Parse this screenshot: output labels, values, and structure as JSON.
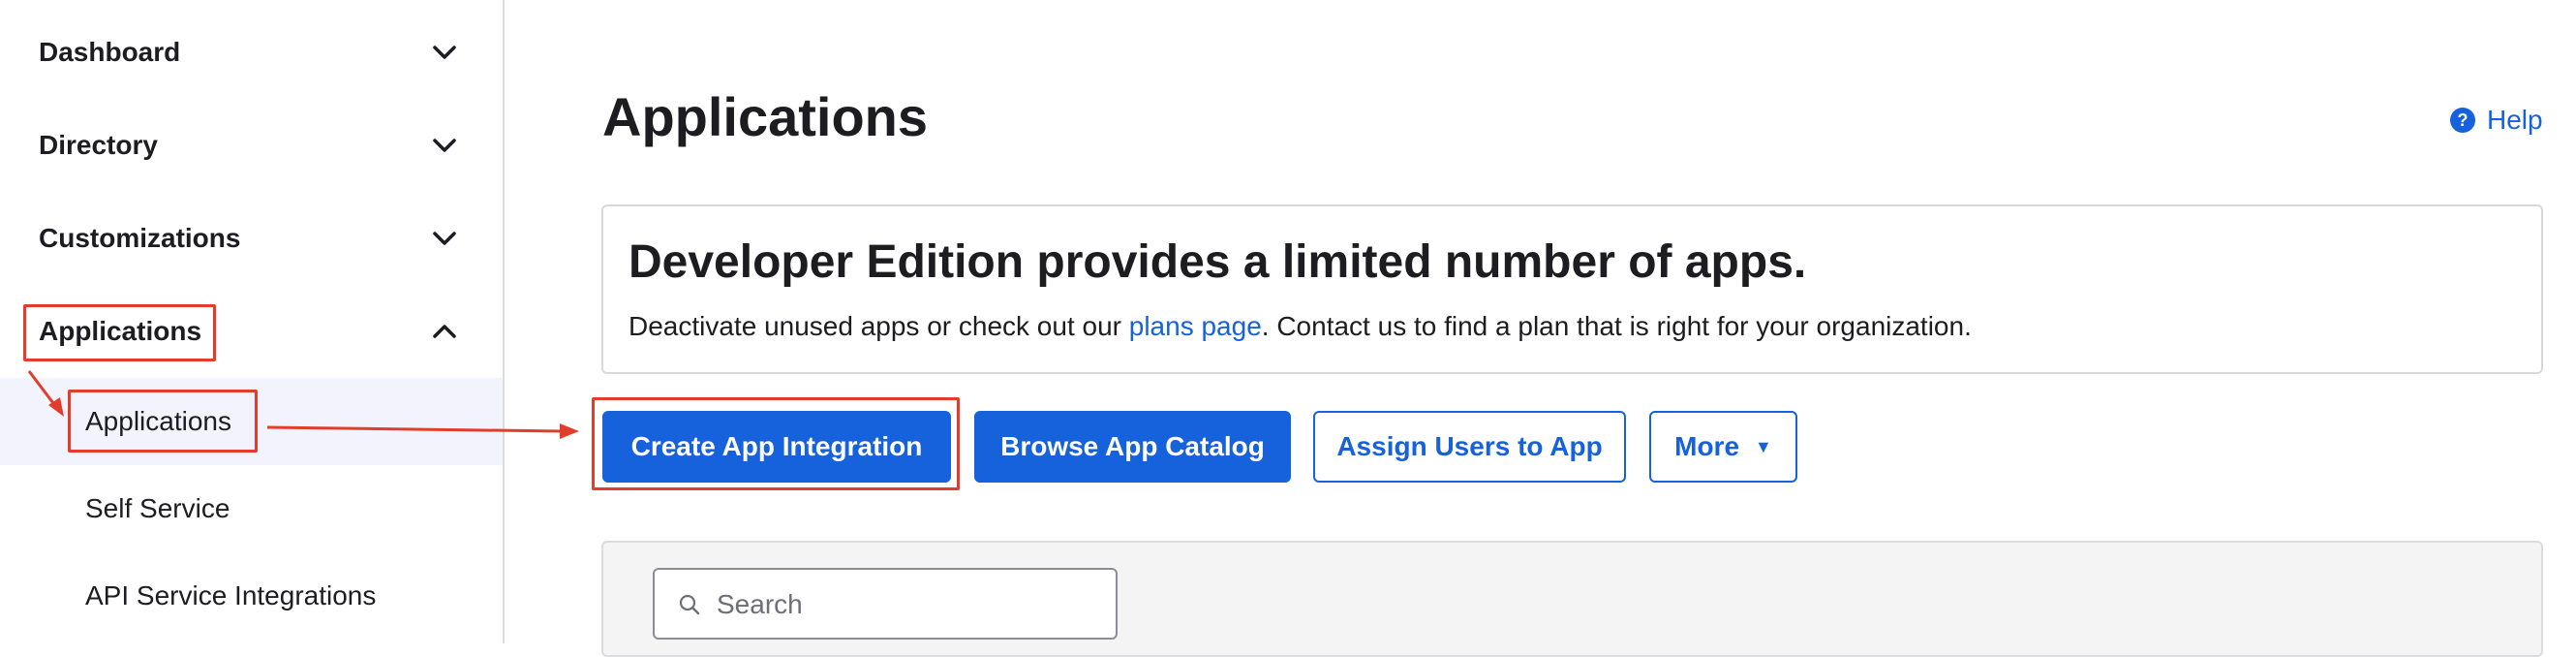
{
  "sidebar": {
    "items": [
      {
        "label": "Dashboard",
        "icon": "chevron-down-icon"
      },
      {
        "label": "Directory",
        "icon": "chevron-down-icon"
      },
      {
        "label": "Customizations",
        "icon": "chevron-down-icon"
      },
      {
        "label": "Applications",
        "icon": "chevron-up-icon"
      }
    ],
    "subitems": [
      {
        "label": "Applications",
        "active": true
      },
      {
        "label": "Self Service",
        "active": false
      },
      {
        "label": "API Service Integrations",
        "active": false
      }
    ]
  },
  "header": {
    "title": "Applications",
    "help_label": "Help",
    "help_icon": "question-circle-icon",
    "help_icon_glyph": "?"
  },
  "notice": {
    "heading": "Developer Edition provides a limited number of apps.",
    "text_before": "Deactivate unused apps or check out our ",
    "link_text": "plans page",
    "text_after": ". Contact us to find a plan that is right for your organization."
  },
  "actions": {
    "create_label": "Create App Integration",
    "browse_label": "Browse App Catalog",
    "assign_label": "Assign Users to App",
    "more_label": "More",
    "more_caret": "▼"
  },
  "search": {
    "placeholder": "Search",
    "value": "",
    "icon": "search-icon"
  },
  "colors": {
    "accent": "#1662dd",
    "annotation": "#e03d2b",
    "active_bg": "#f2f3fd"
  }
}
